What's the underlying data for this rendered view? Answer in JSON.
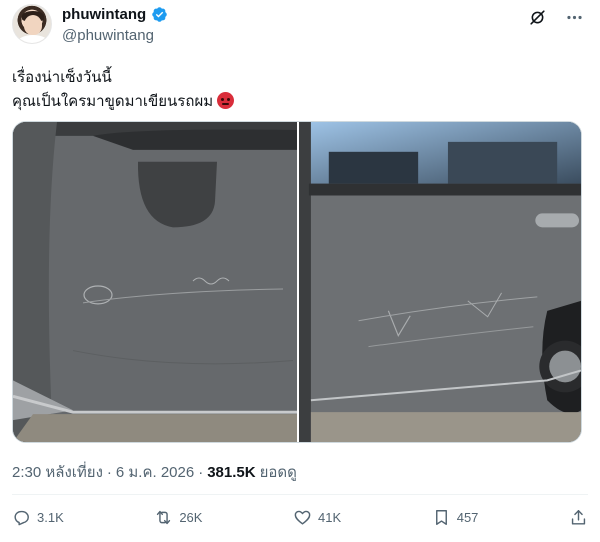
{
  "author": {
    "display_name": "phuwintang",
    "handle": "@phuwintang",
    "verified": true,
    "verified_color": "#1d9bf0"
  },
  "top_icons": [
    "grok-icon",
    "more-icon"
  ],
  "post": {
    "text_line1": "เรื่องน่าเซ็งวันนี้",
    "text_line2": "คุณเป็นใครมาขูดมาเขียนรถผม",
    "emoji": "angry-face-emoji"
  },
  "meta": {
    "time": "2:30 หลังเที่ยง",
    "sep1": "·",
    "date": "6 ม.ค. 2026",
    "sep2": "·",
    "views_count": "381.5K",
    "views_label": "ยอดดู"
  },
  "actions": {
    "replies": "3.1K",
    "reposts": "26K",
    "likes": "41K",
    "bookmarks": "457"
  },
  "colors": {
    "text": "#0f1419",
    "secondary": "#536471",
    "border": "#cfd9de"
  }
}
